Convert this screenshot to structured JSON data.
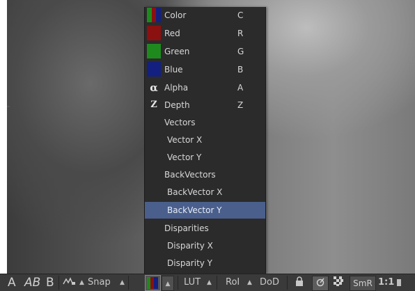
{
  "channel_menu": {
    "items": [
      {
        "label": "Color",
        "shortcut": "C",
        "swatch": "rgb"
      },
      {
        "label": "Red",
        "shortcut": "R",
        "swatch": "#8b1010"
      },
      {
        "label": "Green",
        "shortcut": "G",
        "swatch": "#1e8a1e"
      },
      {
        "label": "Blue",
        "shortcut": "B",
        "swatch": "#142080"
      },
      {
        "label": "Alpha",
        "shortcut": "A",
        "glyph": "α"
      },
      {
        "label": "Depth",
        "shortcut": "Z",
        "glyph": "z"
      },
      {
        "label": "Vectors",
        "shortcut": ""
      },
      {
        "label": "Vector X",
        "shortcut": ""
      },
      {
        "label": "Vector Y",
        "shortcut": ""
      },
      {
        "label": "BackVectors",
        "shortcut": ""
      },
      {
        "label": "BackVector X",
        "shortcut": ""
      },
      {
        "label": "BackVector Y",
        "shortcut": "",
        "highlighted": true
      },
      {
        "label": "Disparities",
        "shortcut": ""
      },
      {
        "label": "Disparity X",
        "shortcut": ""
      },
      {
        "label": "Disparity Y",
        "shortcut": ""
      }
    ],
    "highlight_color": "#4a5f8c"
  },
  "toolbar": {
    "a_label": "A",
    "ab_label": "AB",
    "b_label": "B",
    "snap_label": "Snap",
    "lut_label": "LUT",
    "roi_label": "RoI",
    "dod_label": "DoD",
    "smr_label": "SmR",
    "ratio_label": "1:1",
    "arrow": "▲"
  }
}
